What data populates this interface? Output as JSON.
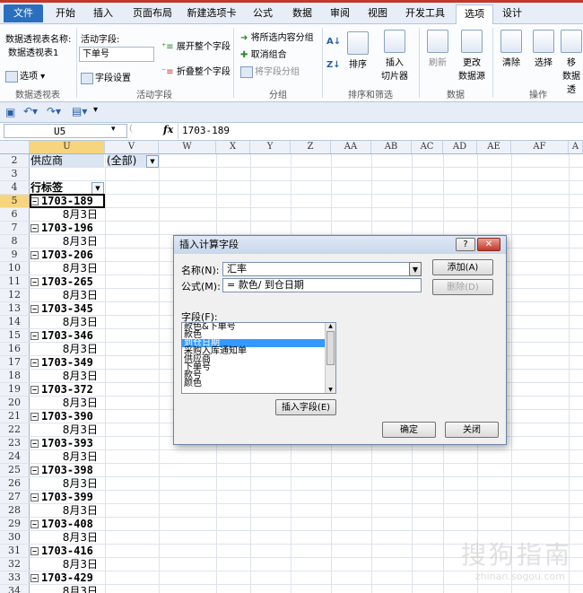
{
  "ribbon_tabs": [
    {
      "label": "文件"
    },
    {
      "label": "开始"
    },
    {
      "label": "插入"
    },
    {
      "label": "页面布局"
    },
    {
      "label": "新建选项卡"
    },
    {
      "label": "公式"
    },
    {
      "label": "数据"
    },
    {
      "label": "审阅"
    },
    {
      "label": "视图"
    },
    {
      "label": "开发工具"
    },
    {
      "label": "选项"
    },
    {
      "label": "设计"
    }
  ],
  "ribbon": {
    "pivot_name_label": "数据透视表名称:",
    "pivot_name_value": "数据透视表1",
    "options_label": "选项",
    "group_pivot": "数据透视表",
    "active_field_label": "活动字段:",
    "active_field_value": "下单号",
    "field_settings": "字段设置",
    "expand_all": "展开整个字段",
    "collapse_all": "折叠整个字段",
    "group_active_field": "活动字段",
    "group_selection": "将所选内容分组",
    "ungroup": "取消组合",
    "group_field": "将字段分组",
    "group_group": "分组",
    "sort": "排序",
    "insert_slicer_1": "插入",
    "insert_slicer_2": "切片器",
    "group_sort_filter": "排序和筛选",
    "refresh": "刷新",
    "change_source_1": "更改",
    "change_source_2": "数据源",
    "group_data": "数据",
    "clear": "清除",
    "select": "选择",
    "move": "移",
    "move_2": "数据透",
    "group_actions": "操作"
  },
  "formula_bar": {
    "name_box": "U5",
    "fx": "fx",
    "formula": "1703-189"
  },
  "columns": [
    "U",
    "V",
    "W",
    "X",
    "Y",
    "Z",
    "AA",
    "AB",
    "AC",
    "AD",
    "AE",
    "AF",
    "A"
  ],
  "sheet": {
    "supplier_label": "供应商",
    "supplier_value": "(全部)",
    "row_labels_header": "行标签",
    "rows": [
      {
        "num": "2"
      },
      {
        "num": "3"
      },
      {
        "num": "4"
      },
      {
        "num": "5",
        "item": "1703-189"
      },
      {
        "num": "6",
        "date": "8月3日"
      },
      {
        "num": "7",
        "item": "1703-196"
      },
      {
        "num": "8",
        "date": "8月3日"
      },
      {
        "num": "9",
        "item": "1703-206"
      },
      {
        "num": "10",
        "date": "8月3日"
      },
      {
        "num": "11",
        "item": "1703-265"
      },
      {
        "num": "12",
        "date": "8月3日"
      },
      {
        "num": "13",
        "item": "1703-345"
      },
      {
        "num": "14",
        "date": "8月3日"
      },
      {
        "num": "15",
        "item": "1703-346"
      },
      {
        "num": "16",
        "date": "8月3日"
      },
      {
        "num": "17",
        "item": "1703-349"
      },
      {
        "num": "18",
        "date": "8月3日"
      },
      {
        "num": "19",
        "item": "1703-372"
      },
      {
        "num": "20",
        "date": "8月3日"
      },
      {
        "num": "21",
        "item": "1703-390"
      },
      {
        "num": "22",
        "date": "8月3日"
      },
      {
        "num": "23",
        "item": "1703-393"
      },
      {
        "num": "24",
        "date": "8月3日"
      },
      {
        "num": "25",
        "item": "1703-398"
      },
      {
        "num": "26",
        "date": "8月3日"
      },
      {
        "num": "27",
        "item": "1703-399"
      },
      {
        "num": "28",
        "date": "8月3日"
      },
      {
        "num": "29",
        "item": "1703-408"
      },
      {
        "num": "30",
        "date": "8月3日"
      },
      {
        "num": "31",
        "item": "1703-416"
      },
      {
        "num": "32",
        "date": "8月3日"
      },
      {
        "num": "33",
        "item": "1703-429"
      },
      {
        "num": "34",
        "date": "8月3日"
      }
    ]
  },
  "dialog": {
    "title": "插入计算字段",
    "help": "?",
    "close_x": "✕",
    "name_label": "名称(N):",
    "name_value": "汇率",
    "formula_label": "公式(M):",
    "formula_value": "= 款色/ 到仓日期",
    "add_button": "添加(A)",
    "delete_button": "删除(D)",
    "fields_label": "字段(F):",
    "fields": [
      "款色&下单号",
      "款色",
      "到仓日期",
      "采购入库通知单",
      "供应商",
      "下单号",
      "款号",
      "颜色"
    ],
    "selected_field": "到仓日期",
    "insert_field_button": "插入字段(E)",
    "ok_button": "确定",
    "close_button": "关闭"
  },
  "watermark": {
    "text": "搜狗指南",
    "sub": "zhinan.sogou.com"
  }
}
